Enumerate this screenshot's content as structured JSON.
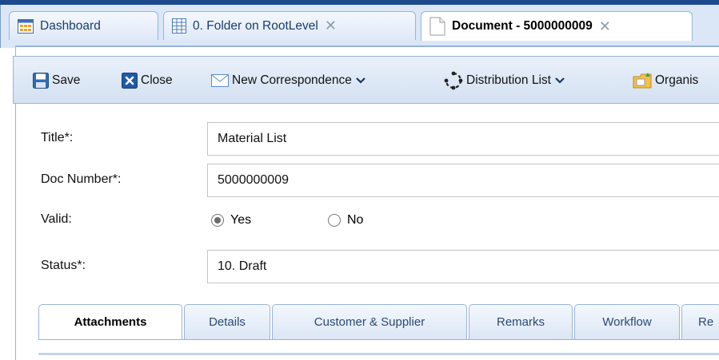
{
  "tabs": [
    {
      "label": "Dashboard",
      "icon": "dashboard-icon",
      "closable": false,
      "active": false
    },
    {
      "label": "0. Folder on RootLevel",
      "icon": "folder-grid-icon",
      "closable": true,
      "active": false
    },
    {
      "label": "Document - 5000000009",
      "icon": "document-icon",
      "closable": true,
      "active": true
    }
  ],
  "tab_close_glyph": "✕",
  "toolbar": {
    "save": "Save",
    "close": "Close",
    "new_correspondence": "New Correspondence",
    "distribution_list": "Distribution List",
    "organise": "Organis"
  },
  "form": {
    "title_label": "Title*:",
    "title_value": "Material List",
    "doc_number_label": "Doc Number*:",
    "doc_number_value": "5000000009",
    "valid_label": "Valid:",
    "valid_yes": "Yes",
    "valid_no": "No",
    "valid_selected": "Yes",
    "status_label": "Status*:",
    "status_value": "10. Draft"
  },
  "subtabs": [
    "Attachments",
    "Details",
    "Customer & Supplier",
    "Remarks",
    "Workflow",
    "Re"
  ],
  "colors": {
    "accent": "#1c4a8c",
    "border": "#99b4d8",
    "tab_bg": "#dbe7f7"
  }
}
